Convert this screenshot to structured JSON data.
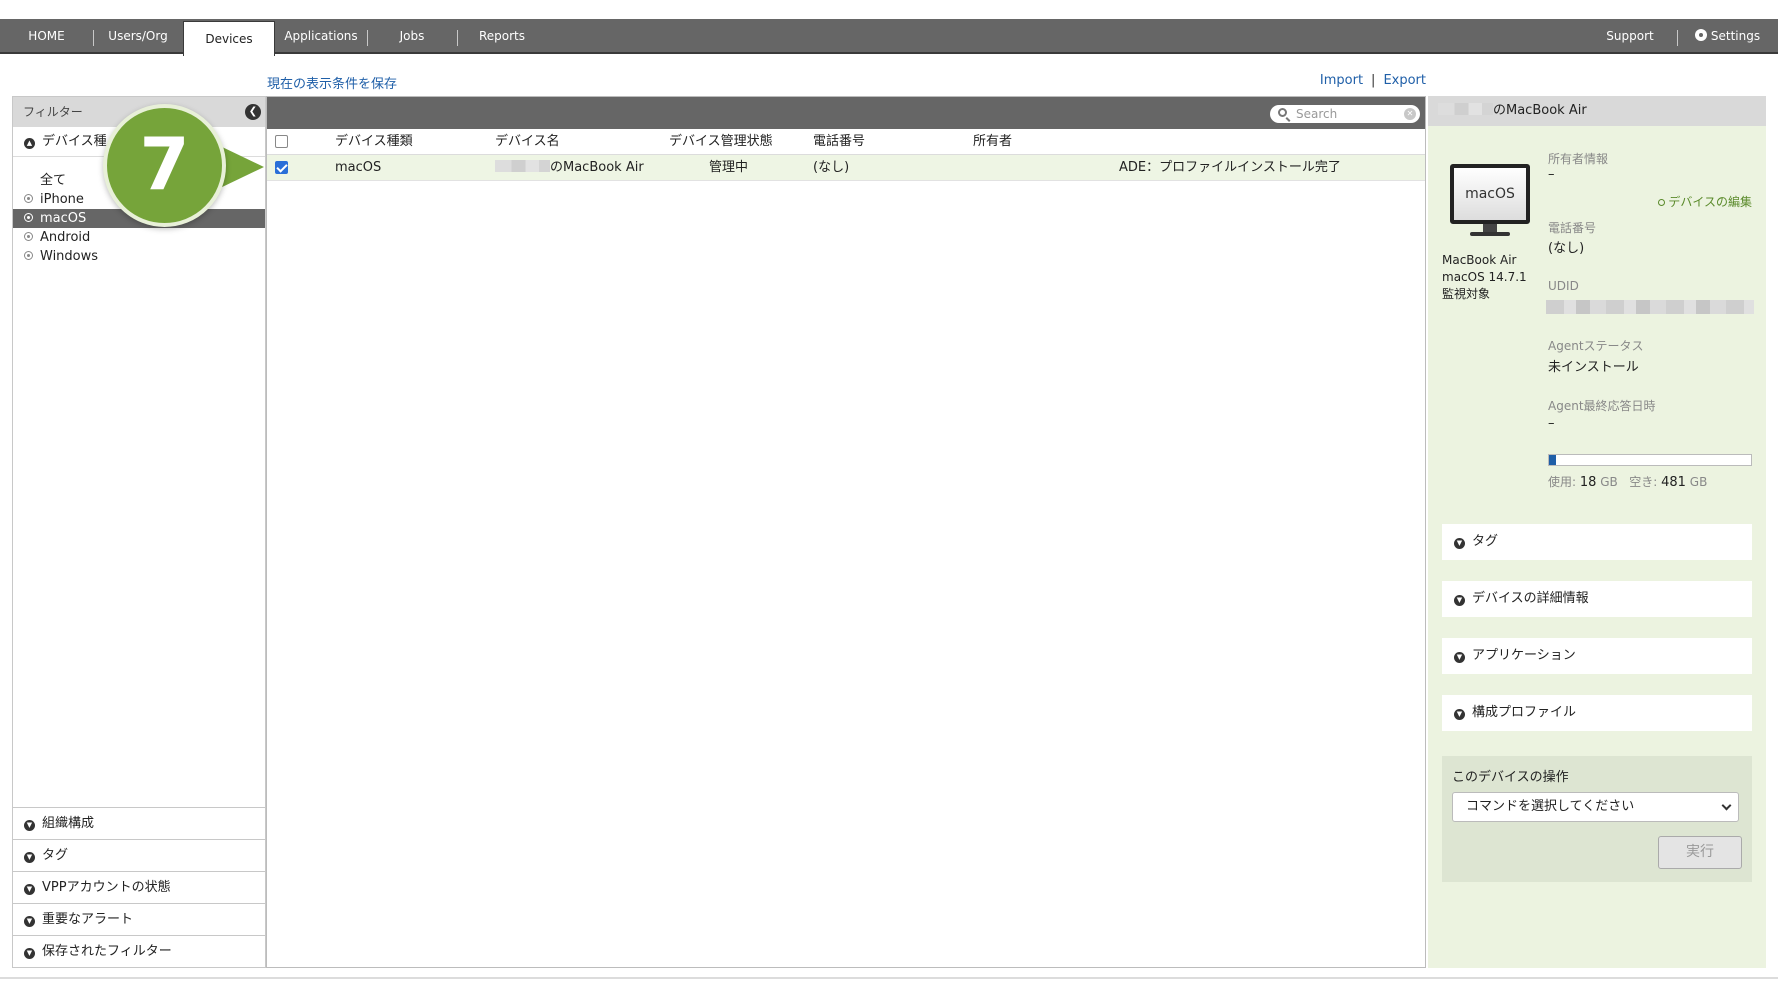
{
  "nav": {
    "tabs": [
      {
        "label": "HOME"
      },
      {
        "label": "Users/Org"
      },
      {
        "label": "Devices",
        "active": true
      },
      {
        "label": "Applications"
      },
      {
        "label": "Jobs"
      },
      {
        "label": "Reports"
      }
    ],
    "support": "Support",
    "settings": "Settings"
  },
  "links": {
    "save_view": "現在の表示条件を保存",
    "import": "Import",
    "export": "Export",
    "separator": "|"
  },
  "filter": {
    "title": "フィルター",
    "device_type_section": "デバイス種",
    "types": [
      "全て",
      "iPhone",
      "macOS",
      "Android",
      "Windows"
    ],
    "selected_type": "macOS",
    "bottom_sections": [
      "組織構成",
      "タグ",
      "VPPアカウントの状態",
      "重要なアラート",
      "保存されたフィルター"
    ]
  },
  "callout": {
    "number": "7"
  },
  "table": {
    "search_placeholder": "Search",
    "columns": [
      "デバイス種類",
      "デバイス名",
      "デバイス管理状態",
      "電話番号",
      "所有者"
    ],
    "rows": [
      {
        "checked": true,
        "type": "macOS",
        "name": "のMacBook Air",
        "status": "管理中",
        "phone": "(なし)",
        "owner": "",
        "ade": "ADE：プロファイルインストール完了"
      }
    ]
  },
  "detail": {
    "title": "のMacBook Air",
    "monitor_label": "macOS",
    "model": "MacBook Air",
    "os": "macOS 14.7.1",
    "supervised": "監視対象",
    "owner_label": "所有者情報",
    "owner_value": "–",
    "edit_label": "デバイスの編集",
    "phone_label": "電話番号",
    "phone_value": "(なし)",
    "udid_label": "UDID",
    "agent_status_label": "Agentステータス",
    "agent_status_value": "未インストール",
    "agent_last_label": "Agent最終応答日時",
    "agent_last_value": "–",
    "storage": {
      "used_fraction": 0.036,
      "used_label": "使用:",
      "used_value": "18",
      "free_label": "空き:",
      "free_value": "481",
      "unit": "GB"
    },
    "sections": [
      "タグ",
      "デバイスの詳細情報",
      "アプリケーション",
      "構成プロファイル"
    ],
    "ops_title": "このデバイスの操作",
    "command_placeholder": "コマンドを選択してください",
    "run_label": "実行"
  }
}
